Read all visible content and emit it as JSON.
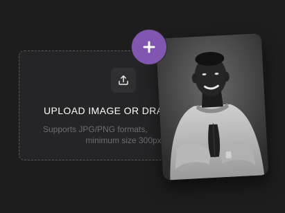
{
  "upload": {
    "title": "UPLOAD IMAGE OR DRAG",
    "hint_line1": "Supports JPG/PNG formats,",
    "hint_line2": "minimum size 300px",
    "icon": "upload-icon"
  },
  "add_button": {
    "icon": "plus-icon"
  },
  "photo": {
    "description_icon": "portrait-photo"
  },
  "colors": {
    "background": "#1d1d1e",
    "accent": "#8056b0",
    "dropzone": "#252527"
  }
}
